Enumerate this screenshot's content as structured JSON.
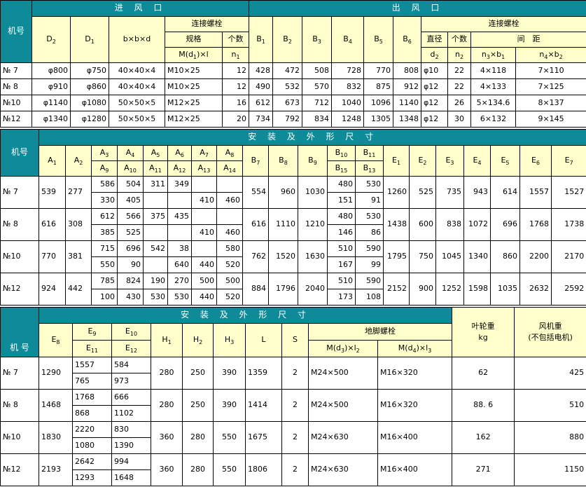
{
  "t1": {
    "machine_label": "机号",
    "inlet_title": "进 风 口",
    "outlet_title": "出 风 口",
    "bolt_title": "连接螺栓",
    "spec_label": "规格",
    "count_label": "个数",
    "dia_label": "直径",
    "count2_label": "个数",
    "spacing_label": "间　距",
    "D2": "D",
    "D2s": "2",
    "D1": "D",
    "D1s": "1",
    "bbd": "b×b×d",
    "Md": "M(d",
    "Mds": "1",
    "Mdt": ")×l",
    "n1": "n",
    "n1s": "1",
    "B1": "B",
    "B1s": "1",
    "B2": "B",
    "B2s": "2",
    "B3": "B",
    "B3s": "3",
    "B4": "B",
    "B4s": "4",
    "B5": "B",
    "B5s": "5",
    "B6": "B",
    "B6s": "6",
    "d2": "d",
    "d2s": "2",
    "n2": "n",
    "n2s": "2",
    "n3": "n",
    "n3s": "3",
    "n3t": "×b",
    "n3u": "1",
    "n4": "n",
    "n4s": "4",
    "n4t": "×b",
    "n4u": "2",
    "rows": [
      [
        "№ 7",
        "φ800",
        "φ750",
        "40×40×4",
        "M10×25",
        "12",
        "428",
        "472",
        "508",
        "728",
        "770",
        "808",
        "φ10",
        "22",
        "4×118",
        "7×110"
      ],
      [
        "№ 8",
        "φ910",
        "φ860",
        "40×40×4",
        "M10×25",
        "12",
        "490",
        "532",
        "570",
        "832",
        "875",
        "912",
        "φ12",
        "22",
        "4×133",
        "7×125"
      ],
      [
        "№10",
        "φ1140",
        "φ1080",
        "50×50×5",
        "M12×25",
        "16",
        "612",
        "673",
        "712",
        "1040",
        "1096",
        "1140",
        "φ12",
        "26",
        "5×134.6",
        "8×137"
      ],
      [
        "№12",
        "φ1340",
        "φ1280",
        "50×50×5",
        "M12×25",
        "20",
        "734",
        "792",
        "834",
        "1248",
        "1305",
        "1348",
        "φ12",
        "30",
        "6×132",
        "9×145"
      ]
    ]
  },
  "t2": {
    "machine_label": "机号",
    "title": "安 装 及 外 形 尺 寸",
    "h": {
      "A1": "1",
      "A2": "2",
      "A3": "3",
      "A4": "4",
      "A5": "5",
      "A6": "6",
      "A7": "7",
      "A8": "8",
      "A9": "9",
      "A10": "10",
      "A11": "11",
      "A12": "12",
      "A13": "13",
      "A14": "14",
      "B7": "7",
      "B8": "8",
      "B9": "9",
      "B10": "10",
      "B11": "11",
      "B15": "15",
      "B13": "13",
      "E1": "1",
      "E2": "2",
      "E3": "3",
      "E4": "4",
      "E5": "5",
      "E6": "6",
      "E7": "7",
      "A": "A",
      "B": "B",
      "E": "E"
    },
    "rows": [
      {
        "no": "№ 7",
        "A1": "539",
        "A2": "277",
        "top": [
          "586",
          "504",
          "311",
          "349",
          "",
          ""
        ],
        "bot": [
          "330",
          "405",
          "",
          "",
          "410",
          "460"
        ],
        "B7": "554",
        "B8": "960",
        "B9": "1030",
        "B10": "480",
        "B11": "530",
        "B15": "151",
        "B13": "91",
        "E": [
          "1260",
          "525",
          "735",
          "943",
          "614",
          "1557",
          "1527"
        ]
      },
      {
        "no": "№ 8",
        "A1": "616",
        "A2": "308",
        "top": [
          "612",
          "566",
          "375",
          "435",
          "",
          ""
        ],
        "bot": [
          "385",
          "525",
          "",
          "",
          "410",
          "460"
        ],
        "B7": "616",
        "B8": "1110",
        "B9": "1210",
        "B10": "480",
        "B11": "530",
        "B15": "146",
        "B13": "86",
        "E": [
          "1438",
          "600",
          "838",
          "1072",
          "696",
          "1768",
          "1738"
        ]
      },
      {
        "no": "№10",
        "A1": "770",
        "A2": "381",
        "top": [
          "715",
          "696",
          "542",
          "38",
          "",
          "580"
        ],
        "bot": [
          "550",
          "90",
          "",
          "640",
          "440",
          "520"
        ],
        "B7": "762",
        "B8": "1520",
        "B9": "1630",
        "B10": "510",
        "B11": "590",
        "B15": "167",
        "B13": "99",
        "E": [
          "1795",
          "750",
          "1045",
          "1340",
          "860",
          "2200",
          "2170"
        ]
      },
      {
        "no": "№12",
        "A1": "924",
        "A2": "442",
        "top": [
          "785",
          "824",
          "190",
          "270",
          "500",
          "500"
        ],
        "bot": [
          "100",
          "430",
          "530",
          "530",
          "440",
          "520"
        ],
        "B7": "884",
        "B8": "1796",
        "B9": "2040",
        "B10": "510",
        "B11": "590",
        "B15": "173",
        "B13": "108",
        "E": [
          "2152",
          "900",
          "1252",
          "1598",
          "1035",
          "2632",
          "2592"
        ]
      }
    ]
  },
  "t3": {
    "machine_label": "机 号",
    "title": "安 装 及 外 形 尺 寸",
    "impeller_label": "叶轮重",
    "impeller_unit": "kg",
    "fan_label": "风机重",
    "fan_note": "(不包括电机)",
    "anchor_label": "地脚螺栓",
    "E": "E",
    "H": "H",
    "E8": "8",
    "E9": "9",
    "E10": "10",
    "E11": "11",
    "E12": "12",
    "H1": "1",
    "H2": "2",
    "H3": "3",
    "L": "L",
    "S": "S",
    "M3": "M(d",
    "M3s": "3",
    "M3t": ")×l",
    "M3u": "2",
    "M4": "M(d",
    "M4s": "4",
    "M4t": ")×l",
    "M4u": "3",
    "rows": [
      {
        "no": "№ 7",
        "E8": "1290",
        "E9": "1557",
        "E10": "584",
        "E11": "765",
        "E12": "973",
        "H1": "280",
        "H2": "250",
        "H3": "390",
        "L": "1359",
        "S": "2",
        "M3": "M24×500",
        "M4": "M16×320",
        "imp": "62",
        "fan": "425"
      },
      {
        "no": "№ 8",
        "E8": "1468",
        "E9": "1768",
        "E10": "666",
        "E11": "868",
        "E12": "1102",
        "H1": "280",
        "H2": "250",
        "H3": "390",
        "L": "1414",
        "S": "2",
        "M3": "M24×500",
        "M4": "M16×320",
        "imp": "88. 6",
        "fan": "510"
      },
      {
        "no": "№10",
        "E8": "1830",
        "E9": "2220",
        "E10": "830",
        "E11": "1080",
        "E12": "1390",
        "H1": "360",
        "H2": "280",
        "H3": "550",
        "L": "1675",
        "S": "2",
        "M3": "M24×630",
        "M4": "M16×400",
        "imp": "162",
        "fan": "880"
      },
      {
        "no": "№12",
        "E8": "2193",
        "E9": "2642",
        "E10": "994",
        "E11": "1293",
        "E12": "1648",
        "H1": "360",
        "H2": "280",
        "H3": "550",
        "L": "1806",
        "S": "2",
        "M3": "M24×630",
        "M4": "M16×400",
        "imp": "271",
        "fan": "1150"
      }
    ]
  }
}
